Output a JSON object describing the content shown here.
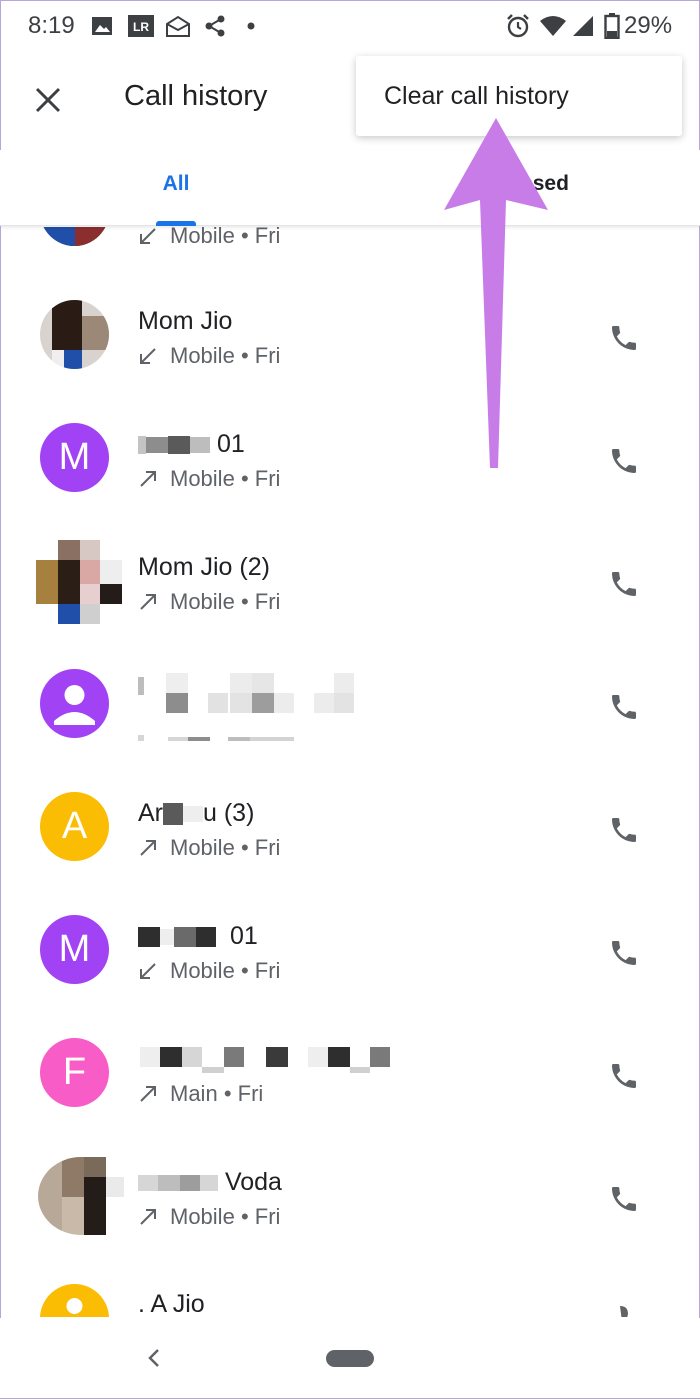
{
  "status_bar": {
    "time": "8:19",
    "battery": "29%",
    "icons": [
      "image-icon",
      "lightroom-icon",
      "mail-icon",
      "share-icon",
      "dot-icon",
      "alarm-icon",
      "wifi-icon",
      "signal-icon",
      "battery-icon"
    ],
    "lr_label": "LR"
  },
  "app_bar": {
    "title": "Call history",
    "close_icon": "close-icon"
  },
  "menu": {
    "clear_label": "Clear call history"
  },
  "tabs": {
    "all": "All",
    "missed": "ssed"
  },
  "colors": {
    "accent": "#1a73e8",
    "purple_avatar": "#a142f4",
    "yellow_avatar": "#fbbc04",
    "pink_avatar": "#f75cc7",
    "annotation_arrow": "#c77ce8"
  },
  "calls": [
    {
      "name": "",
      "type": "Mobile",
      "day": "Fri",
      "direction": "incoming",
      "avatar": "photo"
    },
    {
      "name": "Mom Jio",
      "type": "Mobile",
      "day": "Fri",
      "direction": "incoming",
      "avatar": "photo"
    },
    {
      "name": "01",
      "type": "Mobile",
      "day": "Fri",
      "direction": "outgoing",
      "avatar": "letter",
      "letter": "M"
    },
    {
      "name": "Mom Jio  (2)",
      "type": "Mobile",
      "day": "Fri",
      "direction": "outgoing",
      "avatar": "photo"
    },
    {
      "name": "",
      "type": "",
      "day": "",
      "direction": "",
      "avatar": "person"
    },
    {
      "name_prefix": "Ar",
      "name_suffix": "u  (3)",
      "type": "Mobile",
      "day": "Fri",
      "direction": "outgoing",
      "avatar": "letter",
      "letter": "A"
    },
    {
      "name": "01",
      "type": "Mobile",
      "day": "Fri",
      "direction": "incoming",
      "avatar": "letter",
      "letter": "M"
    },
    {
      "name": "",
      "type": "Main",
      "day": "Fri",
      "direction": "outgoing",
      "avatar": "letter",
      "letter": "F"
    },
    {
      "name": "Voda",
      "type": "Mobile",
      "day": "Fri",
      "direction": "outgoing",
      "avatar": "photo"
    },
    {
      "name": ". A Jio",
      "type": "",
      "day": "",
      "direction": "",
      "avatar": "letter-partial"
    }
  ],
  "separator": "•"
}
